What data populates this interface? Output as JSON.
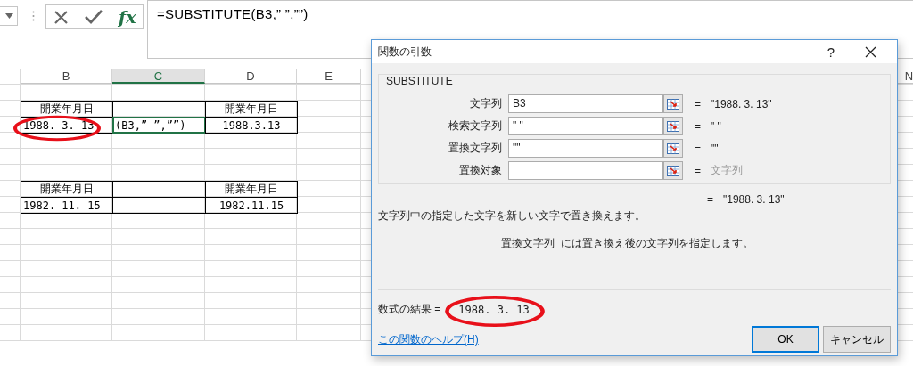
{
  "formula_bar": {
    "function_label": "fx",
    "formula": "=SUBSTITUTE(B3,” ”,””)"
  },
  "sheet": {
    "columns": [
      {
        "label": "B",
        "selected": false
      },
      {
        "label": "C",
        "selected": true
      },
      {
        "label": "D",
        "selected": false
      },
      {
        "label": "E",
        "selected": false
      },
      {
        "label": "N",
        "selected": false
      }
    ],
    "rows": [
      {
        "kind": "blank"
      },
      {
        "kind": "header",
        "b": {
          "text": "開業年月日",
          "selected": false,
          "circled": false
        },
        "d": {
          "text": "開業年月日",
          "selected": false,
          "circled": false
        }
      },
      {
        "kind": "data",
        "b": {
          "text": "1988. 3. 13",
          "selected": false,
          "circled": true
        },
        "c": {
          "text": "(B3,” ”,””)",
          "selected": true,
          "circled": false
        },
        "d": {
          "text": "1988.3.13",
          "selected": false,
          "circled": false
        }
      },
      {
        "kind": "blank"
      },
      {
        "kind": "blank"
      },
      {
        "kind": "blank"
      },
      {
        "kind": "header",
        "b": {
          "text": "開業年月日",
          "selected": false,
          "circled": false
        },
        "d": {
          "text": "開業年月日",
          "selected": false,
          "circled": false
        }
      },
      {
        "kind": "data",
        "b": {
          "text": "1982. 11. 15",
          "selected": false,
          "circled": false
        },
        "d": {
          "text": "1982.11.15",
          "selected": false,
          "circled": false
        }
      },
      {
        "kind": "blank"
      },
      {
        "kind": "blank"
      },
      {
        "kind": "blank"
      },
      {
        "kind": "blank"
      },
      {
        "kind": "blank"
      },
      {
        "kind": "blank"
      },
      {
        "kind": "blank"
      },
      {
        "kind": "blank"
      }
    ]
  },
  "dialog": {
    "title": "関数の引数",
    "help_button": "?",
    "function_name": "SUBSTITUTE",
    "arguments": [
      {
        "label": "文字列",
        "value": "B3",
        "result": "\"1988. 3. 13\"",
        "result_muted": false
      },
      {
        "label": "検索文字列",
        "value": "\" \"",
        "result": "\" \"",
        "result_muted": false
      },
      {
        "label": "置換文字列",
        "value": "\"\"",
        "result": "\"\"",
        "result_muted": false
      },
      {
        "label": "置換対象",
        "result": "文字列",
        "result_muted": true
      }
    ],
    "equals": "=",
    "overall_result": "\"1988. 3. 13\"",
    "description": "文字列中の指定した文字を新しい文字で置き換えます。",
    "argument_help": "置換文字列  には置き換え後の文字列を指定します。",
    "formula_result_label": "数式の結果 =",
    "formula_result": {
      "text": "1988. 3. 13",
      "circled": true
    },
    "help_link": "この関数のヘルプ(H)",
    "buttons": [
      {
        "label": "OK",
        "focused": true
      },
      {
        "label": "キャンセル",
        "focused": false
      }
    ]
  }
}
